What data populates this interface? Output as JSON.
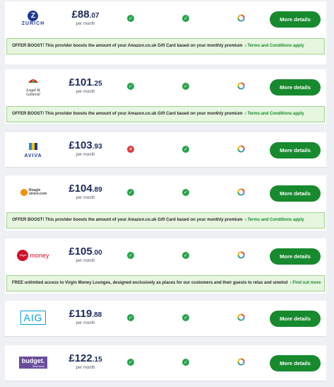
{
  "per_month_label": "per month",
  "button_label": "More details",
  "quotes": [
    {
      "provider": "ZURICH",
      "price_int": "£88",
      "price_dec": ".07",
      "col1": "yes",
      "col2": "yes",
      "offer": {
        "text": "OFFER BOOST! This provider boosts the amount of your Amazon.co.uk Gift Card based on your monthly premium",
        "link": "› Terms and Conditions apply"
      }
    },
    {
      "provider": "Legal & General",
      "price_int": "£101",
      "price_dec": ".25",
      "col1": "yes",
      "col2": "yes",
      "offer": {
        "text": "OFFER BOOST! This provider boosts the amount of your Amazon.co.uk Gift Card based on your monthly premium",
        "link": "› Terms and Conditions apply"
      }
    },
    {
      "provider": "AVIVA",
      "price_int": "£103",
      "price_dec": ".93",
      "col1": "no",
      "col2": "yes",
      "offer": null
    },
    {
      "provider": "Beagle Street",
      "price_int": "£104",
      "price_dec": ".89",
      "col1": "yes",
      "col2": "yes",
      "offer": {
        "text": "OFFER BOOST! This provider boosts the amount of your Amazon.co.uk Gift Card based on your monthly premium",
        "link": "› Terms and Conditions apply"
      }
    },
    {
      "provider": "Virgin money",
      "price_int": "£105",
      "price_dec": ".00",
      "col1": "yes",
      "col2": "yes",
      "offer": {
        "text": "FREE unlimited access to Virgin Money Lounges, designed exclusively as places for our customers and their guests to relax and unwind",
        "link": "› Find out more"
      }
    },
    {
      "provider": "AIG",
      "price_int": "£119",
      "price_dec": ".88",
      "col1": "yes",
      "col2": "yes",
      "offer": null
    },
    {
      "provider": "budget. insurance",
      "price_int": "£122",
      "price_dec": ".15",
      "col1": "yes",
      "col2": "yes",
      "offer": null
    }
  ],
  "logos": {
    "zurich": {
      "word": "ZURICH",
      "mark": "Z",
      "color": "#1f3a93"
    },
    "lg": {
      "word": "Legal & General"
    },
    "aviva": {
      "word": "AVIVA",
      "color": "#1f3a93"
    },
    "beagle": {
      "word": "Beagle street.com"
    },
    "virgin": {
      "word": "money",
      "mark": "Virgin",
      "color": "#d0102b"
    },
    "aig": {
      "word": "AIG",
      "color": "#00a3d9"
    },
    "budget": {
      "word": "budget.",
      "sub": "insurance",
      "color": "#6a4c9c"
    }
  },
  "colors": {
    "accent": "#178a2e",
    "check": "#27a34a",
    "cross": "#d93a3a",
    "offer_bg": "#e6f6df",
    "price": "#1c2a5a"
  }
}
